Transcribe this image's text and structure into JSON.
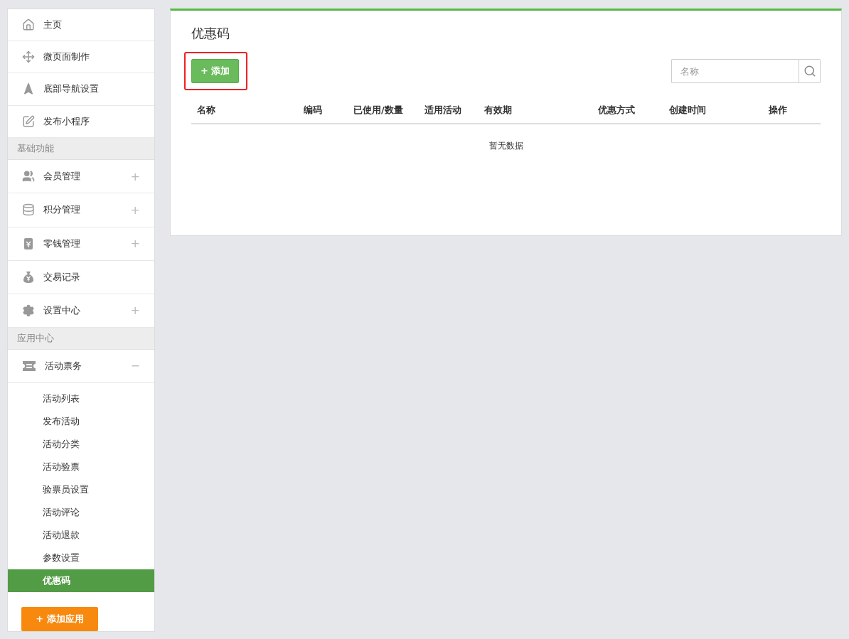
{
  "sidebar": {
    "items": [
      {
        "kind": "item",
        "label": "主页"
      },
      {
        "kind": "item",
        "label": "微页面制作"
      },
      {
        "kind": "item",
        "label": "底部导航设置"
      },
      {
        "kind": "item",
        "label": "发布小程序"
      },
      {
        "kind": "section",
        "label": "基础功能"
      },
      {
        "kind": "item",
        "label": "会员管理",
        "toggle": "+"
      },
      {
        "kind": "item",
        "label": "积分管理",
        "toggle": "+"
      },
      {
        "kind": "item",
        "label": "零钱管理",
        "toggle": "+"
      },
      {
        "kind": "item",
        "label": "交易记录"
      },
      {
        "kind": "item",
        "label": "设置中心",
        "toggle": "+"
      },
      {
        "kind": "section",
        "label": "应用中心"
      },
      {
        "kind": "item",
        "label": "活动票务",
        "toggle": "−",
        "children": [
          {
            "label": "活动列表",
            "selected": false
          },
          {
            "label": "发布活动",
            "selected": false
          },
          {
            "label": "活动分类",
            "selected": false
          },
          {
            "label": "活动验票",
            "selected": false
          },
          {
            "label": "验票员设置",
            "selected": false
          },
          {
            "label": "活动评论",
            "selected": false
          },
          {
            "label": "活动退款",
            "selected": false
          },
          {
            "label": "参数设置",
            "selected": false
          },
          {
            "label": "优惠码",
            "selected": true
          }
        ]
      }
    ],
    "add_app_button": "+ 添加应用"
  },
  "main": {
    "title": "优惠码",
    "add_button": {
      "label": "+ 添加",
      "highlighted": true
    },
    "search": {
      "placeholder": "名称"
    },
    "table": {
      "columns": [
        "名称",
        "编码",
        "已使用/数量",
        "适用活动",
        "有效期",
        "优惠方式",
        "创建时间",
        "操作"
      ],
      "empty_text": "暂无数据"
    }
  }
}
